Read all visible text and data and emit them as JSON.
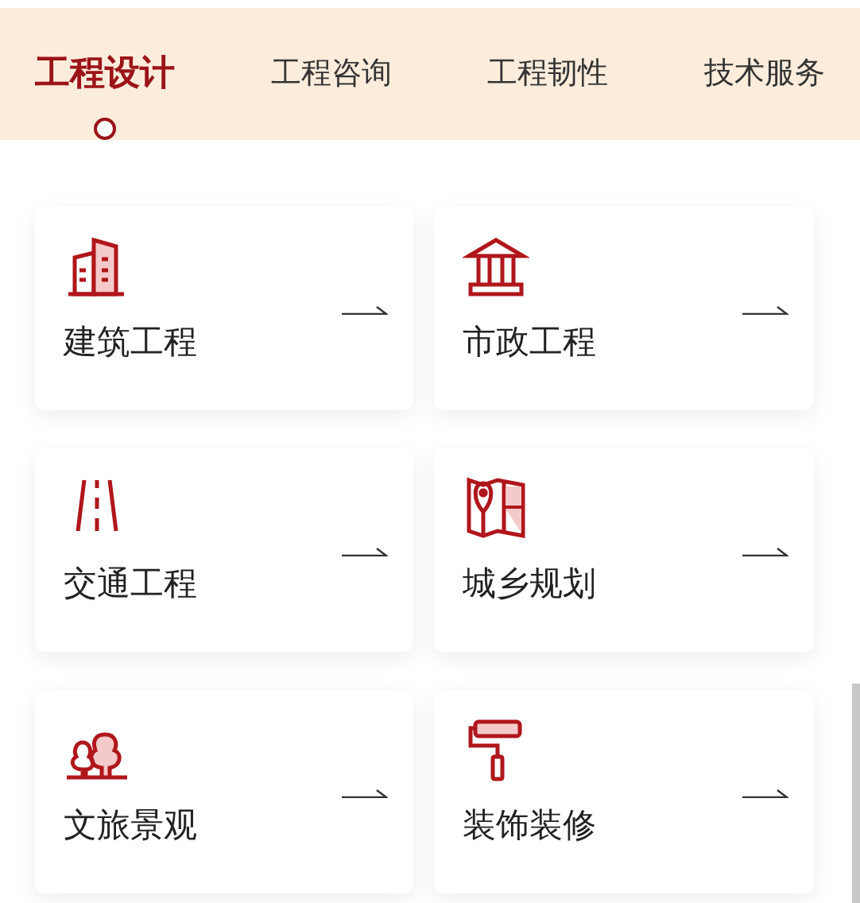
{
  "tabs": [
    {
      "label": "工程设计",
      "selected": true
    },
    {
      "label": "工程咨询",
      "selected": false
    },
    {
      "label": "工程韧性",
      "selected": false
    },
    {
      "label": "技术服务",
      "selected": false
    }
  ],
  "cards": [
    {
      "label": "建筑工程",
      "kind": "building"
    },
    {
      "label": "市政工程",
      "kind": "bank"
    },
    {
      "label": "交通工程",
      "kind": "road"
    },
    {
      "label": "城乡规划",
      "kind": "map"
    },
    {
      "label": "文旅景观",
      "kind": "trees"
    },
    {
      "label": "装饰装修",
      "kind": "roller"
    }
  ]
}
